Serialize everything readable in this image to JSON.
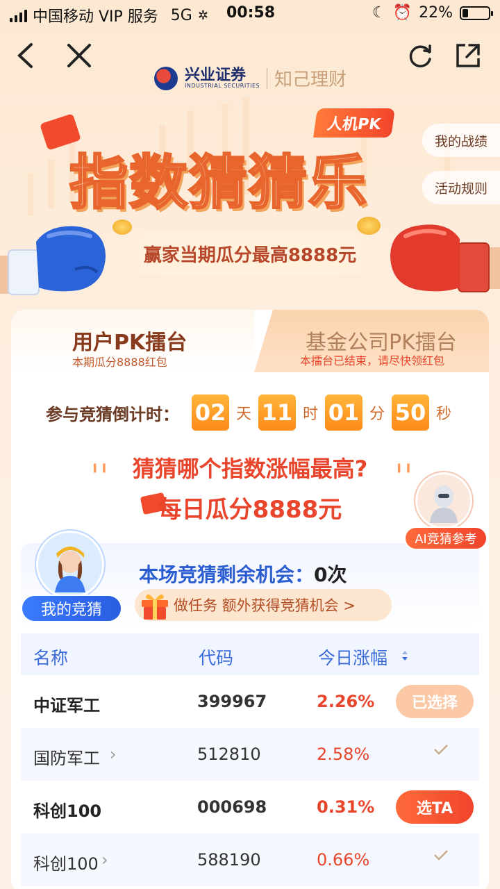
{
  "status_bar": {
    "carrier": "中国移动 VIP 服务",
    "network": "5G",
    "time": "00:58",
    "battery_percent": "22%",
    "battery_level": 0.22
  },
  "brand": {
    "name": "兴业证券",
    "name_en": "INDUSTRIAL SECURITIES",
    "tagline": "知己理财"
  },
  "hero": {
    "tag": "人机PK",
    "title": "指数猜猜乐",
    "prize": "赢家当期瓜分最高8888元",
    "side_buttons": [
      "我的战绩",
      "活动规则"
    ]
  },
  "tabs": [
    {
      "title": "用户PK擂台",
      "subtitle": "本期瓜分8888红包",
      "active": true
    },
    {
      "title": "基金公司PK擂台",
      "subtitle": "本擂台已结束，请尽快领红包",
      "active": false
    }
  ],
  "countdown": {
    "label": "参与竞猜倒计时：",
    "days": "02",
    "days_unit": "天",
    "hours": "11",
    "hours_unit": "时",
    "minutes": "01",
    "minutes_unit": "分",
    "seconds": "50",
    "seconds_unit": "秒"
  },
  "question": "猜猜哪个指数涨幅最高?",
  "daily_prize": "每日瓜分8888元",
  "ai_tag": "AI竞猜参考",
  "my_guess": {
    "tag": "我的竞猜",
    "remain_label": "本场竞猜剩余机会：",
    "remain_count": "0次",
    "task": "做任务 额外获得竞猜机会 >"
  },
  "table": {
    "headers": {
      "name": "名称",
      "code": "代码",
      "change": "今日涨幅"
    },
    "rows": [
      {
        "name": "中证军工",
        "code": "399967",
        "change": "2.26%",
        "action": "已选择",
        "type": "selected"
      },
      {
        "name": "国防军工",
        "code": "512810",
        "change": "2.58%",
        "action": "",
        "type": "check"
      },
      {
        "name": "科创100",
        "code": "000698",
        "change": "0.31%",
        "action": "选TA",
        "type": "pick"
      },
      {
        "name": "科创100",
        "code": "588190",
        "change": "0.66%",
        "action": "",
        "type": "check"
      }
    ]
  }
}
